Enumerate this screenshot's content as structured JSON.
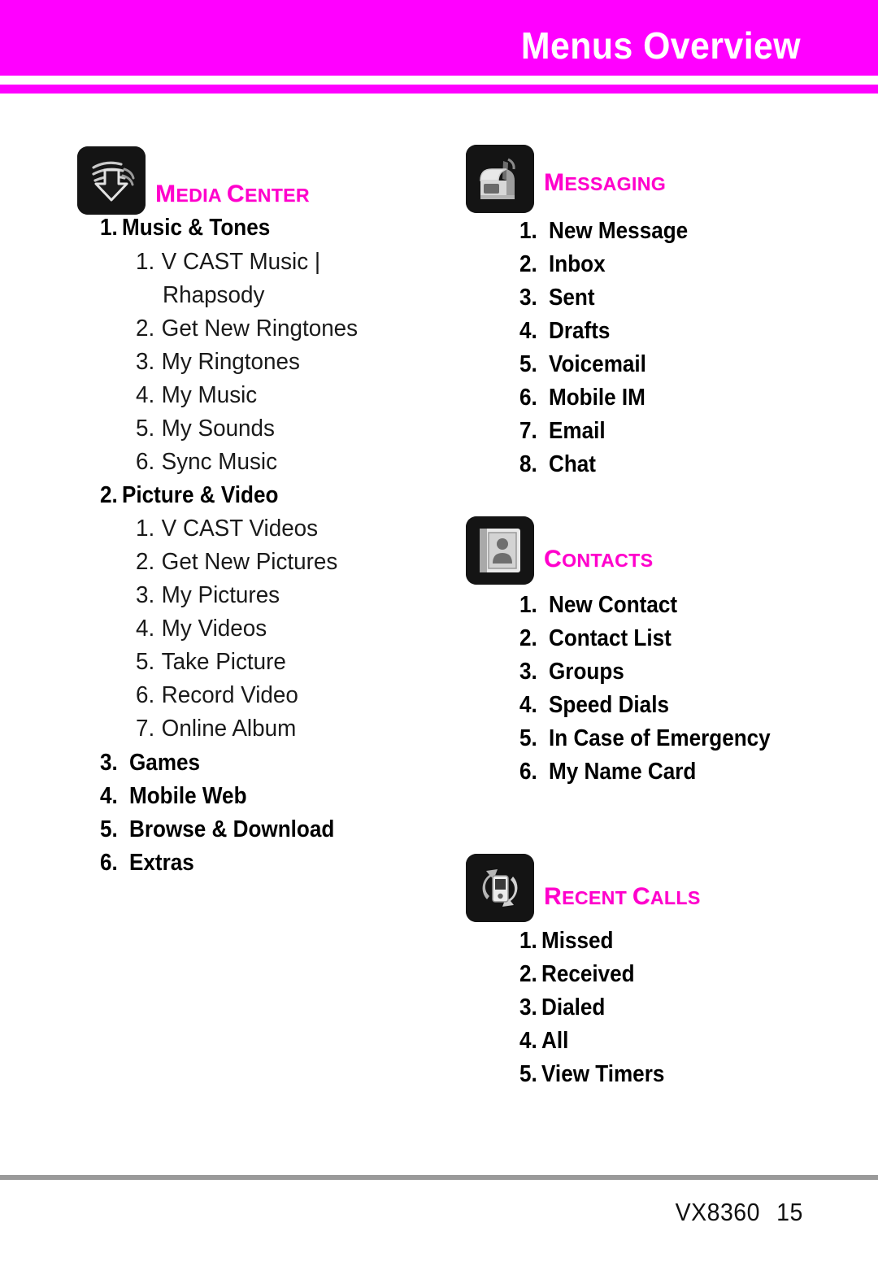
{
  "page": {
    "header_title": "Menus Overview",
    "accent_color": "#ff00ff",
    "title_color": "#ff00cc",
    "footer_model": "VX8360",
    "footer_page": "15",
    "footer_rule_color": "#9a9a9a"
  },
  "sections": {
    "media_center": {
      "title_first": "M",
      "title_rest": "EDIA ",
      "title_second": "C",
      "title_rest2": "ENTER",
      "icon": "media-center-icon",
      "items": [
        {
          "num": "1.",
          "label": "Music & Tones"
        },
        {
          "num": "1.",
          "label": "V CAST Music |"
        },
        {
          "num": "",
          "label": "Rhapsody"
        },
        {
          "num": "2.",
          "label": "Get New Ringtones"
        },
        {
          "num": "3.",
          "label": "My Ringtones"
        },
        {
          "num": "4.",
          "label": "My Music"
        },
        {
          "num": "5.",
          "label": "My Sounds"
        },
        {
          "num": "6.",
          "label": "Sync Music"
        },
        {
          "num": "2.",
          "label": "Picture & Video"
        },
        {
          "num": "1.",
          "label": "V CAST Videos"
        },
        {
          "num": "2.",
          "label": "Get New Pictures"
        },
        {
          "num": "3.",
          "label": "My Pictures"
        },
        {
          "num": "4.",
          "label": "My Videos"
        },
        {
          "num": "5.",
          "label": "Take Picture"
        },
        {
          "num": "6.",
          "label": "Record Video"
        },
        {
          "num": "7.",
          "label": "Online Album"
        },
        {
          "num": "3.",
          "label": "Games"
        },
        {
          "num": "4.",
          "label": "Mobile Web"
        },
        {
          "num": "5.",
          "label": "Browse & Download"
        },
        {
          "num": "6.",
          "label": "Extras"
        }
      ]
    },
    "messaging": {
      "title_first": "M",
      "title_rest": "ESSAGING",
      "icon": "mailbox-icon",
      "items": [
        {
          "num": "1.",
          "label": "New Message"
        },
        {
          "num": "2.",
          "label": "Inbox"
        },
        {
          "num": "3.",
          "label": "Sent"
        },
        {
          "num": "4.",
          "label": "Drafts"
        },
        {
          "num": "5.",
          "label": "Voicemail"
        },
        {
          "num": "6.",
          "label": "Mobile IM"
        },
        {
          "num": "7.",
          "label": "Email"
        },
        {
          "num": "8.",
          "label": "Chat"
        }
      ]
    },
    "contacts": {
      "title_first": "C",
      "title_rest": "ONTACTS",
      "icon": "address-book-icon",
      "items": [
        {
          "num": "1.",
          "label": "New Contact"
        },
        {
          "num": "2.",
          "label": "Contact List"
        },
        {
          "num": "3.",
          "label": "Groups"
        },
        {
          "num": "4.",
          "label": "Speed Dials"
        },
        {
          "num": "5.",
          "label": "In Case of Emergency"
        },
        {
          "num": "6.",
          "label": "My Name Card"
        }
      ]
    },
    "recent_calls": {
      "title_first": "R",
      "title_rest": "ECENT ",
      "title_second": "C",
      "title_rest2": "ALLS",
      "icon": "recent-calls-icon",
      "items": [
        {
          "num": "1.",
          "label": "Missed"
        },
        {
          "num": "2.",
          "label": "Received"
        },
        {
          "num": "3.",
          "label": "Dialed"
        },
        {
          "num": "4.",
          "label": "All"
        },
        {
          "num": "5.",
          "label": "View Timers"
        }
      ]
    }
  }
}
